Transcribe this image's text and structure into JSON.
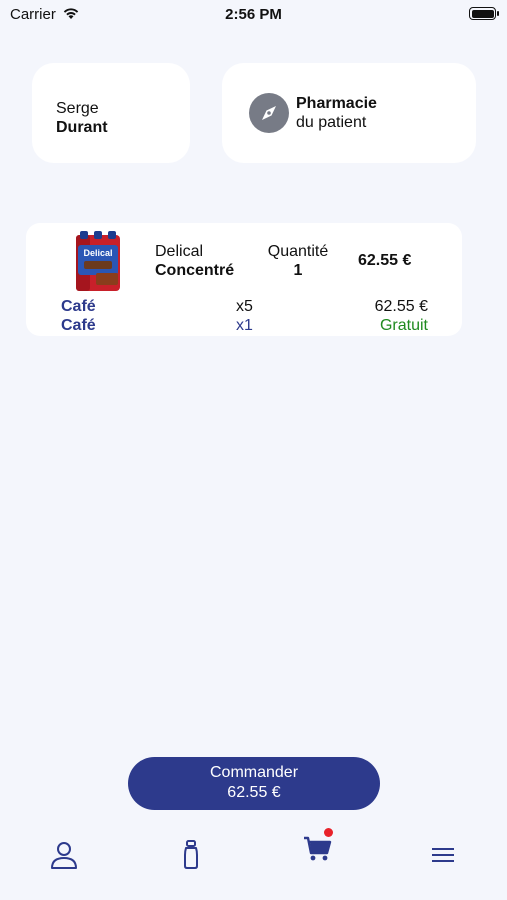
{
  "status_bar": {
    "carrier": "Carrier",
    "time": "2:56 PM"
  },
  "patient": {
    "first_name": "Serge",
    "last_name": "Durant"
  },
  "pharmacy": {
    "title": "Pharmacie",
    "subtitle": "du patient",
    "icon": "compass-icon"
  },
  "order_item": {
    "brand": "Delical",
    "product": "Concentré",
    "quantity_label": "Quantité",
    "quantity_value": "1",
    "total": "62.55 €",
    "image_text": "Delical",
    "lines": [
      {
        "flavor": "Café",
        "count": "x5",
        "price": "62.55 €"
      },
      {
        "flavor": "Café",
        "count": "x1",
        "price": "Gratuit"
      }
    ]
  },
  "order_button": {
    "label": "Commander",
    "amount": "62.55 €"
  },
  "tabbar": {
    "items": [
      "profile-icon",
      "bottle-icon",
      "cart-icon",
      "menu-icon"
    ],
    "cart_badge_color": "#e8222a"
  },
  "colors": {
    "accent": "#2d3a8c",
    "free": "#1f8a1f",
    "background": "#f4f6fc"
  }
}
